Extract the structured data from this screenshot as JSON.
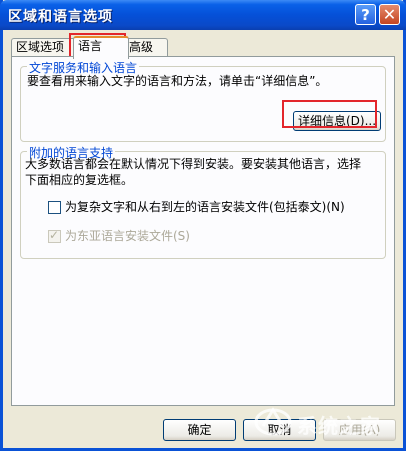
{
  "window": {
    "title": "区域和语言选项"
  },
  "titlebar": {
    "help_icon": "?",
    "close_icon": "✕"
  },
  "tabs": [
    {
      "label": "区域选项"
    },
    {
      "label": "语言"
    },
    {
      "label": "高级"
    }
  ],
  "text_services": {
    "title": "文字服务和输入语言",
    "description": "要查看用来输入文字的语言和方法，请单击“详细信息”。",
    "details_button": "详细信息(D)..."
  },
  "supplemental": {
    "title": "附加的语言支持",
    "description_line1": "大多数语言都会在默认情况下得到安装。要安装其他语言，选择",
    "description_line2": "下面相应的复选框。",
    "complex_script_label": "为复杂文字和从右到左的语言安装文件(包括泰文)(N)",
    "complex_script_checked": false,
    "east_asian_label": "为东亚语言安装文件(S)",
    "east_asian_checked": true
  },
  "footer": {
    "ok": "确定",
    "cancel": "取消",
    "apply": "应用(A)"
  },
  "watermark": {
    "text": "系统之家"
  }
}
